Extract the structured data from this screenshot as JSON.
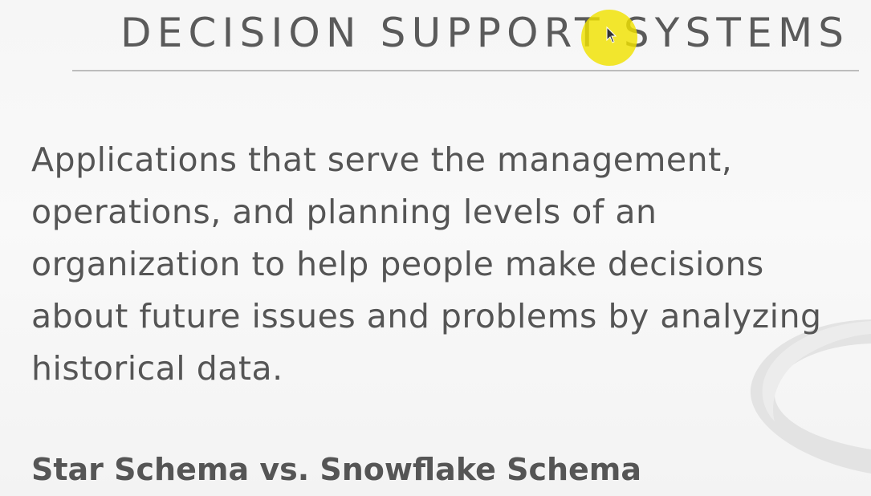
{
  "slide": {
    "title": "DECISION SUPPORT SYSTEMS",
    "body_lines": [
      "Applications that serve the management,",
      "operations, and planning levels of an",
      "organization to help people make decisions",
      "about future issues and problems by analyzing",
      "historical data."
    ],
    "subheading": "Star Schema vs. Snowflake Schema"
  },
  "colors": {
    "background": "#f7f7f7",
    "text": "#555555",
    "rule": "#bdbdbd",
    "cursor_highlight": "#f0e200"
  },
  "icons": {
    "cursor": "mouse-cursor-icon",
    "decoration": "curved-swoosh-decoration"
  }
}
